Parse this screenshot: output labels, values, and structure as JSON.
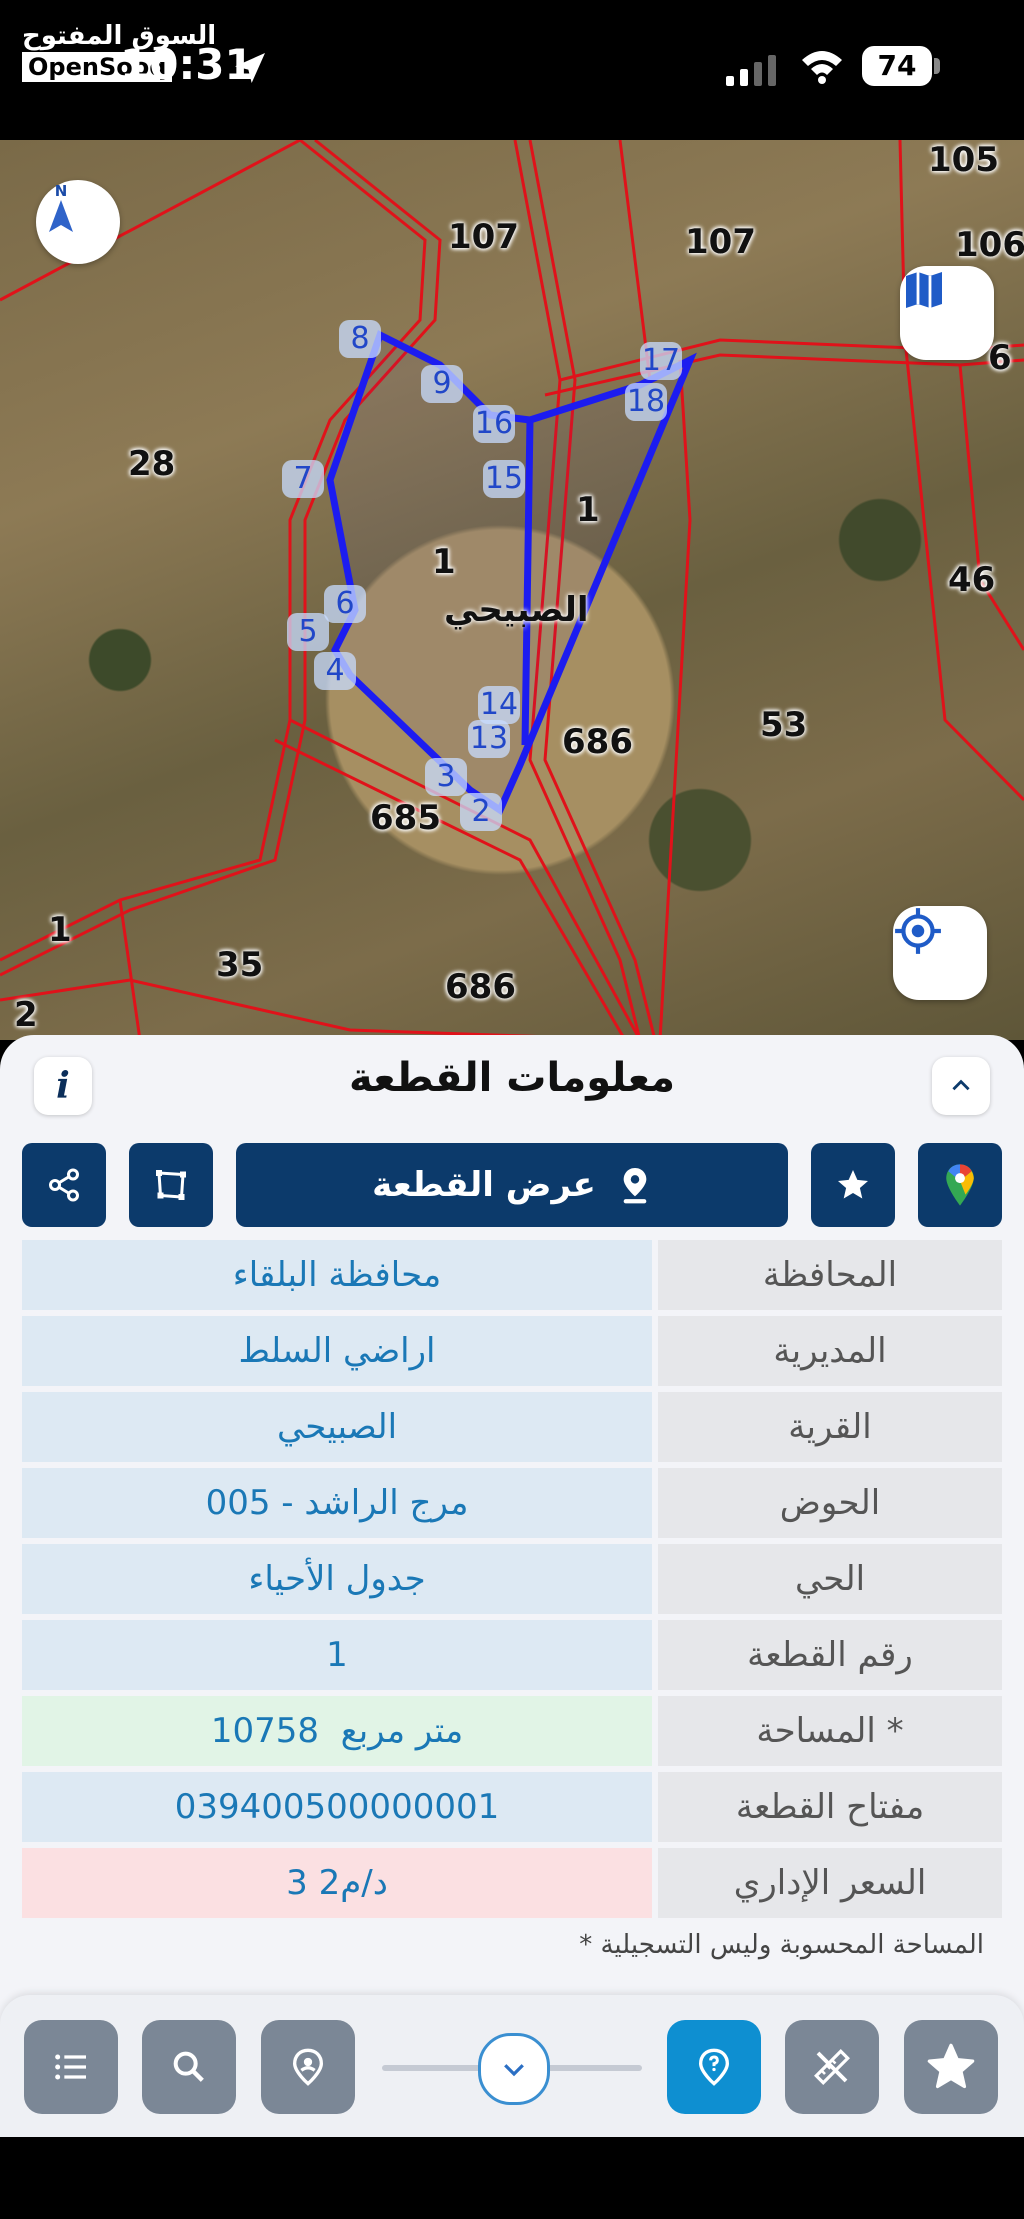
{
  "status_bar": {
    "watermark_ar": "السوق المفتوح",
    "watermark_en": "OpenSooq",
    "time": "10:31",
    "battery": "74"
  },
  "map": {
    "parcel_labels": [
      "107",
      "107",
      "105",
      "106",
      "6",
      "28",
      "1",
      "1",
      "46",
      "53",
      "686",
      "685",
      "1",
      "35",
      "686",
      "2"
    ],
    "village_label": "الصبيحي",
    "vertex_labels": [
      "2",
      "3",
      "4",
      "5",
      "6",
      "7",
      "8",
      "9",
      "13",
      "14",
      "15",
      "16",
      "17",
      "18"
    ],
    "compass_label": "N",
    "icons": {
      "compass": "compass-icon",
      "layers": "map-layers-icon",
      "locate": "locate-icon"
    }
  },
  "sheet": {
    "title": "معلومات القطعة",
    "info_label": "i",
    "actions": {
      "show_parcel": "عرض القطعة"
    },
    "rows": [
      {
        "label": "المحافظة",
        "value": "محافظة البلقاء"
      },
      {
        "label": "المديرية",
        "value": "اراضي السلط"
      },
      {
        "label": "القرية",
        "value": "الصبيحي"
      },
      {
        "label": "الحوض",
        "value": "مرج الراشد - 005"
      },
      {
        "label": "الحي",
        "value": "جدول الأحياء"
      },
      {
        "label": "رقم القطعة",
        "value": "1"
      },
      {
        "label": "المساحة *",
        "value": "10758  متر مربع"
      },
      {
        "label": "مفتاح القطعة",
        "value": "039400500000001"
      },
      {
        "label": "السعر الإداري",
        "value": "3 د/م2"
      }
    ],
    "footnote": "* المساحة المحسوبة وليس التسجيلية"
  },
  "colors": {
    "primary": "#0c3a6b",
    "value_text": "#1a78b6",
    "active_tab": "#0e8fd1",
    "parcel_border": "#e0121a",
    "selection": "#1c1cf0"
  }
}
